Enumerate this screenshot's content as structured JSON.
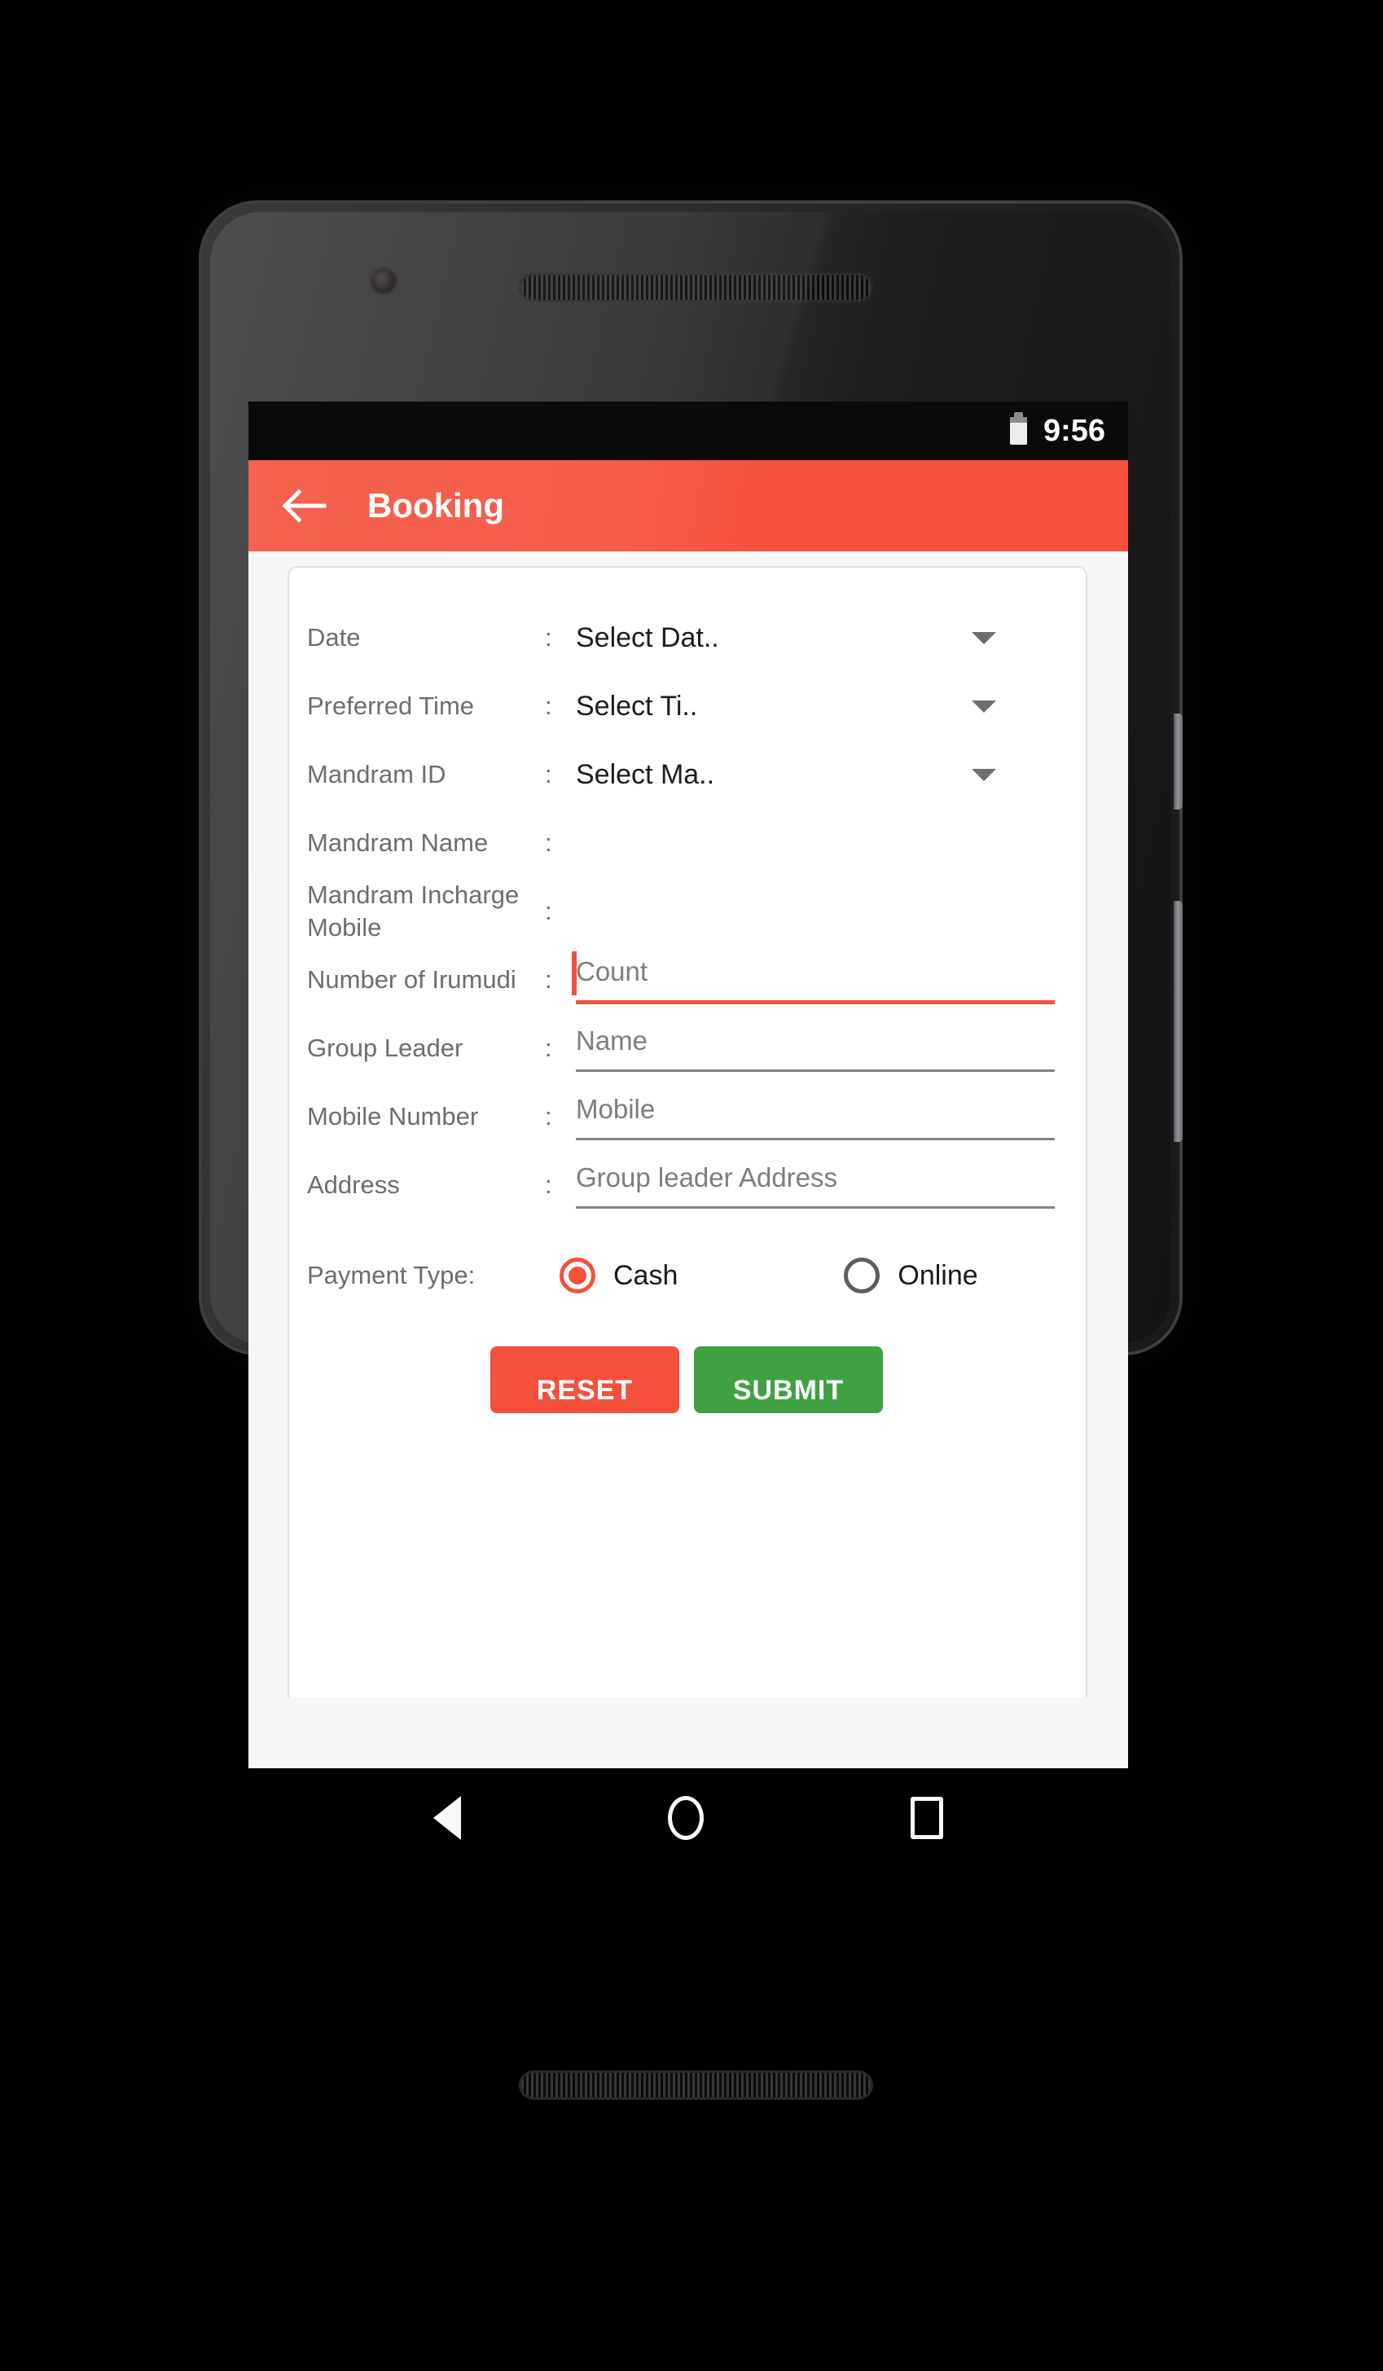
{
  "status_bar": {
    "time": "9:56",
    "battery_icon": "battery-icon"
  },
  "app_bar": {
    "back_icon": "arrow-left-icon",
    "title": "Booking",
    "background_color": "#F4503C"
  },
  "form": {
    "rows": [
      {
        "label": "Date",
        "colon": ":",
        "type": "dropdown",
        "value": "Select Dat..",
        "caret_icon": "chevron-down-icon"
      },
      {
        "label": "Preferred Time",
        "colon": ":",
        "type": "dropdown",
        "value": "Select Ti..",
        "caret_icon": "chevron-down-icon"
      },
      {
        "label": "Mandram ID",
        "colon": ":",
        "type": "dropdown",
        "value": "Select Ma..",
        "caret_icon": "chevron-down-icon"
      },
      {
        "label": "Mandram Name",
        "colon": ":",
        "type": "readonly",
        "value": ""
      },
      {
        "label": "Mandram Incharge Mobile",
        "colon": ":",
        "type": "readonly",
        "value": ""
      },
      {
        "label": "Number of Irumudi",
        "colon": ":",
        "type": "input",
        "value": "",
        "placeholder": "Count",
        "focused": true
      },
      {
        "label": "Group Leader",
        "colon": ":",
        "type": "input",
        "value": "",
        "placeholder": "Name",
        "focused": false
      },
      {
        "label": "Mobile Number",
        "colon": ":",
        "type": "input",
        "value": "",
        "placeholder": "Mobile",
        "focused": false
      },
      {
        "label": "Address",
        "colon": ":",
        "type": "input",
        "value": "",
        "placeholder": "Group leader Address",
        "focused": false
      }
    ],
    "payment": {
      "label": "Payment Type:",
      "options": [
        {
          "label": "Cash",
          "selected": true
        },
        {
          "label": "Online",
          "selected": false
        }
      ]
    },
    "actions": {
      "reset_label": "RESET",
      "submit_label": "SUBMIT",
      "reset_color": "#F4503C",
      "submit_color": "#3FA141"
    }
  },
  "nav_bar": {
    "back_icon": "triangle-back-icon",
    "home_icon": "circle-home-icon",
    "recents_icon": "square-recents-icon"
  }
}
